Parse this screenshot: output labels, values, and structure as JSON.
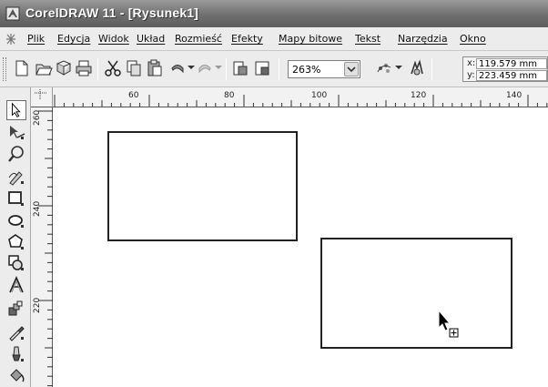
{
  "window": {
    "title": "CorelDRAW 11 - [Rysunek1]"
  },
  "menu": {
    "items": [
      "Plik",
      "Edycja",
      "Widok",
      "Układ",
      "Rozmieść",
      "Efekty",
      "Mapy bitowe",
      "Tekst",
      "Narzędzia",
      "Okno"
    ]
  },
  "toolbar": {
    "zoom_value": "263%",
    "coord_x_label": "x:",
    "coord_x_value": "119.579 mm",
    "coord_y_label": "y:",
    "coord_y_value": "223.459 mm",
    "buttons": [
      "new-icon",
      "open-icon",
      "save-icon",
      "print-icon",
      "cut-icon",
      "copy-icon",
      "paste-icon",
      "undo-icon",
      "redo-icon",
      "import-icon",
      "export-icon",
      "zoom-dropdown",
      "app-launcher-icon",
      "corel-online-icon"
    ]
  },
  "rulers": {
    "horizontal": [
      "60",
      "80",
      "100",
      "120",
      "140"
    ],
    "vertical": [
      "260",
      "240",
      "220"
    ]
  },
  "toolbox": {
    "tools": [
      "pick-tool-icon",
      "shape-tool-icon",
      "zoom-tool-icon",
      "freehand-tool-icon",
      "rectangle-tool-icon",
      "ellipse-tool-icon",
      "polygon-tool-icon",
      "basic-shapes-tool-icon",
      "text-tool-icon",
      "interactive-blend-tool-icon",
      "eyedropper-tool-icon",
      "outline-tool-icon",
      "fill-tool-icon"
    ]
  },
  "colors": {
    "titlebar": "#6f6f6f",
    "menubar": "#ececec",
    "canvas": "#ffffff",
    "shape_outline": "#222222"
  }
}
